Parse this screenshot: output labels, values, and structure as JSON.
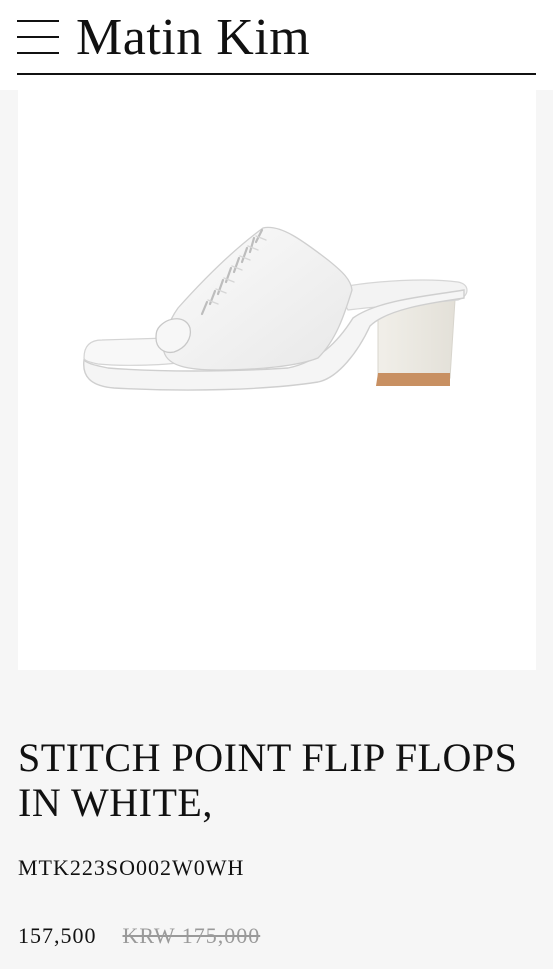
{
  "header": {
    "brand": "Matin Kim",
    "menu_icon": "hamburger-menu-icon"
  },
  "product": {
    "image_alt": "White stitch point flip flop mule with block heel",
    "title": "STITCH POINT FLIP FLOPS IN WHITE,",
    "sku": "MTK223SO002W0WH",
    "price_sale": "157,500",
    "price_original": "KRW 175,000"
  },
  "colors": {
    "page_background": "#f6f6f6",
    "header_background": "#ffffff",
    "text": "#111111",
    "strikethrough_price": "#9a9a9a",
    "heel_wood": "#c89062"
  }
}
